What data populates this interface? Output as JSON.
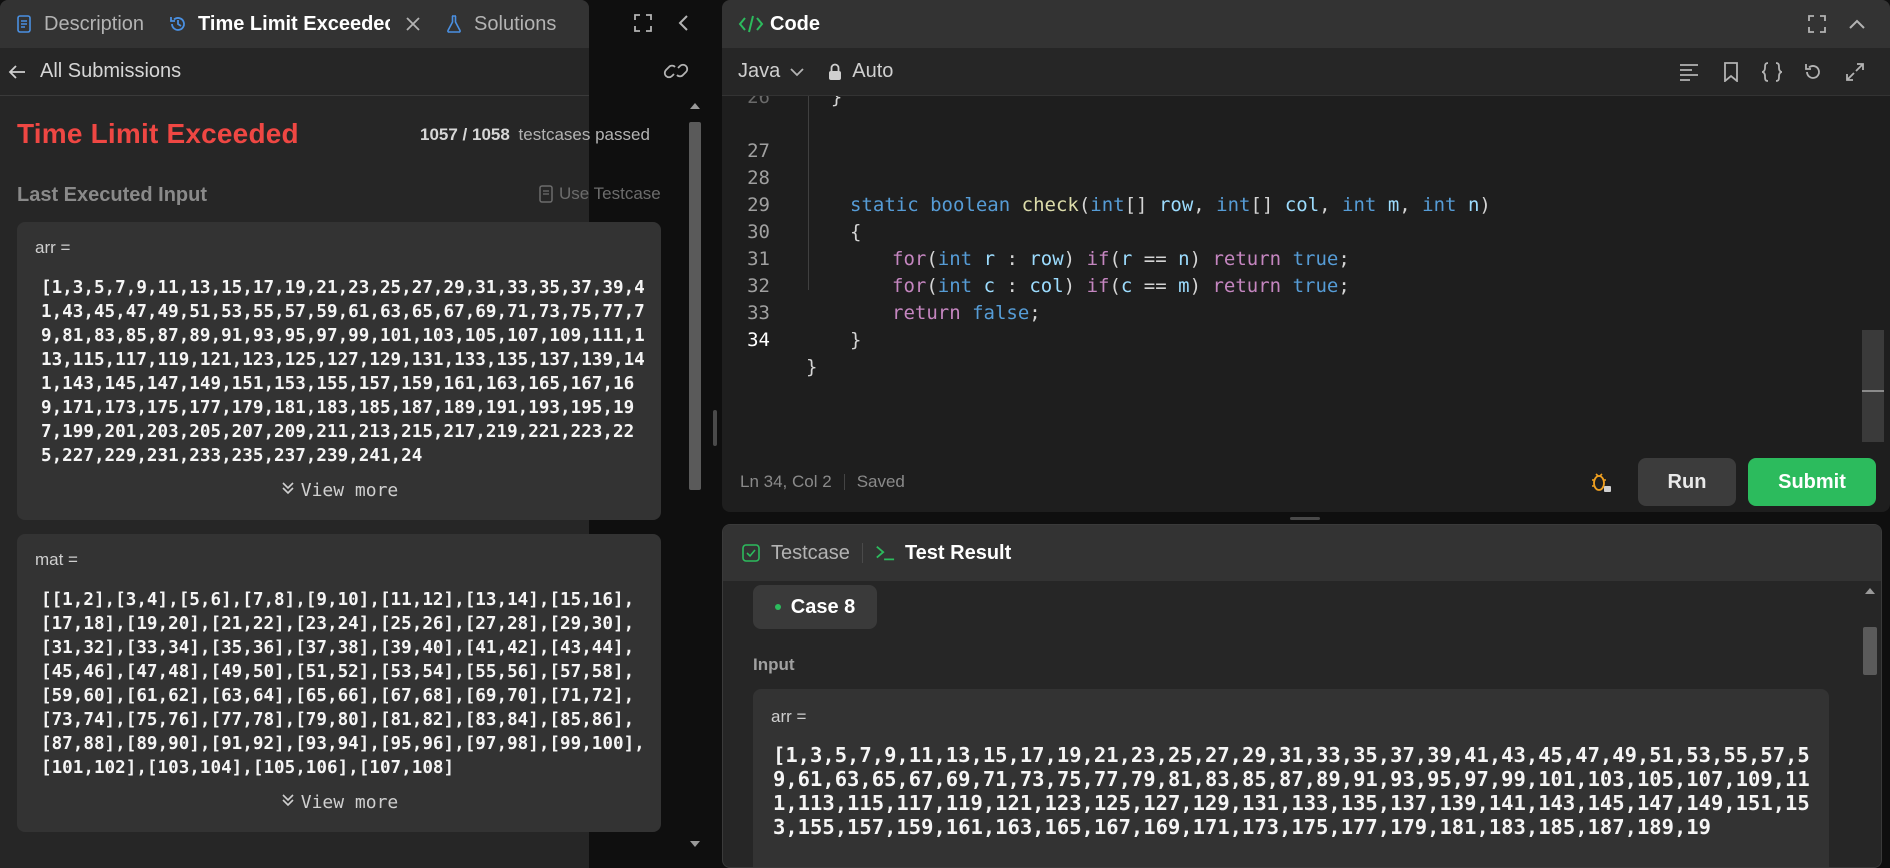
{
  "left_panel": {
    "tabs": [
      {
        "label": "Description",
        "icon": "description-icon"
      },
      {
        "label": "Time Limit Exceedec",
        "icon": "history-icon"
      },
      {
        "label": "Solutions",
        "icon": "flask-icon"
      }
    ],
    "back_label": "All Submissions",
    "status": "Time Limit Exceeded",
    "passed_count": "1057 / 1058",
    "passed_suffix": "testcases passed",
    "last_input_title": "Last Executed Input",
    "use_testcase_label": "Use Testcase",
    "inputs": [
      {
        "label": "arr =",
        "value": "[1,3,5,7,9,11,13,15,17,19,21,23,25,27,29,31,33,35,37,39,41,43,45,47,49,51,53,55,57,59,61,63,65,67,69,71,73,75,77,79,81,83,85,87,89,91,93,95,97,99,101,103,105,107,109,111,113,115,117,119,121,123,125,127,129,131,133,135,137,139,141,143,145,147,149,151,153,155,157,159,161,163,165,167,169,171,173,175,177,179,181,183,185,187,189,191,193,195,197,199,201,203,205,207,209,211,213,215,217,219,221,223,225,227,229,231,233,235,237,239,241,24",
        "view_more": "View more"
      },
      {
        "label": "mat =",
        "value": "[[1,2],[3,4],[5,6],[7,8],[9,10],[11,12],[13,14],[15,16],[17,18],[19,20],[21,22],[23,24],[25,26],[27,28],[29,30],[31,32],[33,34],[35,36],[37,38],[39,40],[41,42],[43,44],[45,46],[47,48],[49,50],[51,52],[53,54],[55,56],[57,58],[59,60],[61,62],[63,64],[65,66],[67,68],[69,70],[71,72],[73,74],[75,76],[77,78],[79,80],[81,82],[83,84],[85,86],[87,88],[89,90],[91,92],[93,94],[95,96],[97,98],[99,100],[101,102],[103,104],[105,106],[107,108]",
        "view_more": "View more"
      }
    ]
  },
  "code_panel": {
    "title": "Code",
    "language": "Java",
    "mode": "Auto",
    "cursor_position": "Ln 34, Col 2",
    "save_state": "Saved",
    "run_label": "Run",
    "submit_label": "Submit",
    "lines": [
      {
        "n": "27"
      },
      {
        "n": "28"
      },
      {
        "n": "29"
      },
      {
        "n": "30"
      },
      {
        "n": "31"
      },
      {
        "n": "32"
      },
      {
        "n": "33"
      },
      {
        "n": "34"
      }
    ]
  },
  "result_panel": {
    "tab_testcase": "Testcase",
    "tab_result": "Test Result",
    "case_label": "Case 8",
    "input_title": "Input",
    "input_label": "arr =",
    "input_value": "[1,3,5,7,9,11,13,15,17,19,21,23,25,27,29,31,33,35,37,39,41,43,45,47,49,51,53,55,57,59,61,63,65,67,69,71,73,75,77,79,81,83,85,87,89,91,93,95,97,99,101,103,105,107,109,111,113,115,117,119,121,123,125,127,129,131,133,135,137,139,141,143,145,147,149,151,153,155,157,159,161,163,165,167,169,171,173,175,177,179,181,183,185,187,189,19"
  },
  "colors": {
    "status_red": "#ef4743",
    "accent_green": "#2cbb5d",
    "code_icon_green": "#2cbb5d",
    "tab_blue": "#4a90e2"
  }
}
